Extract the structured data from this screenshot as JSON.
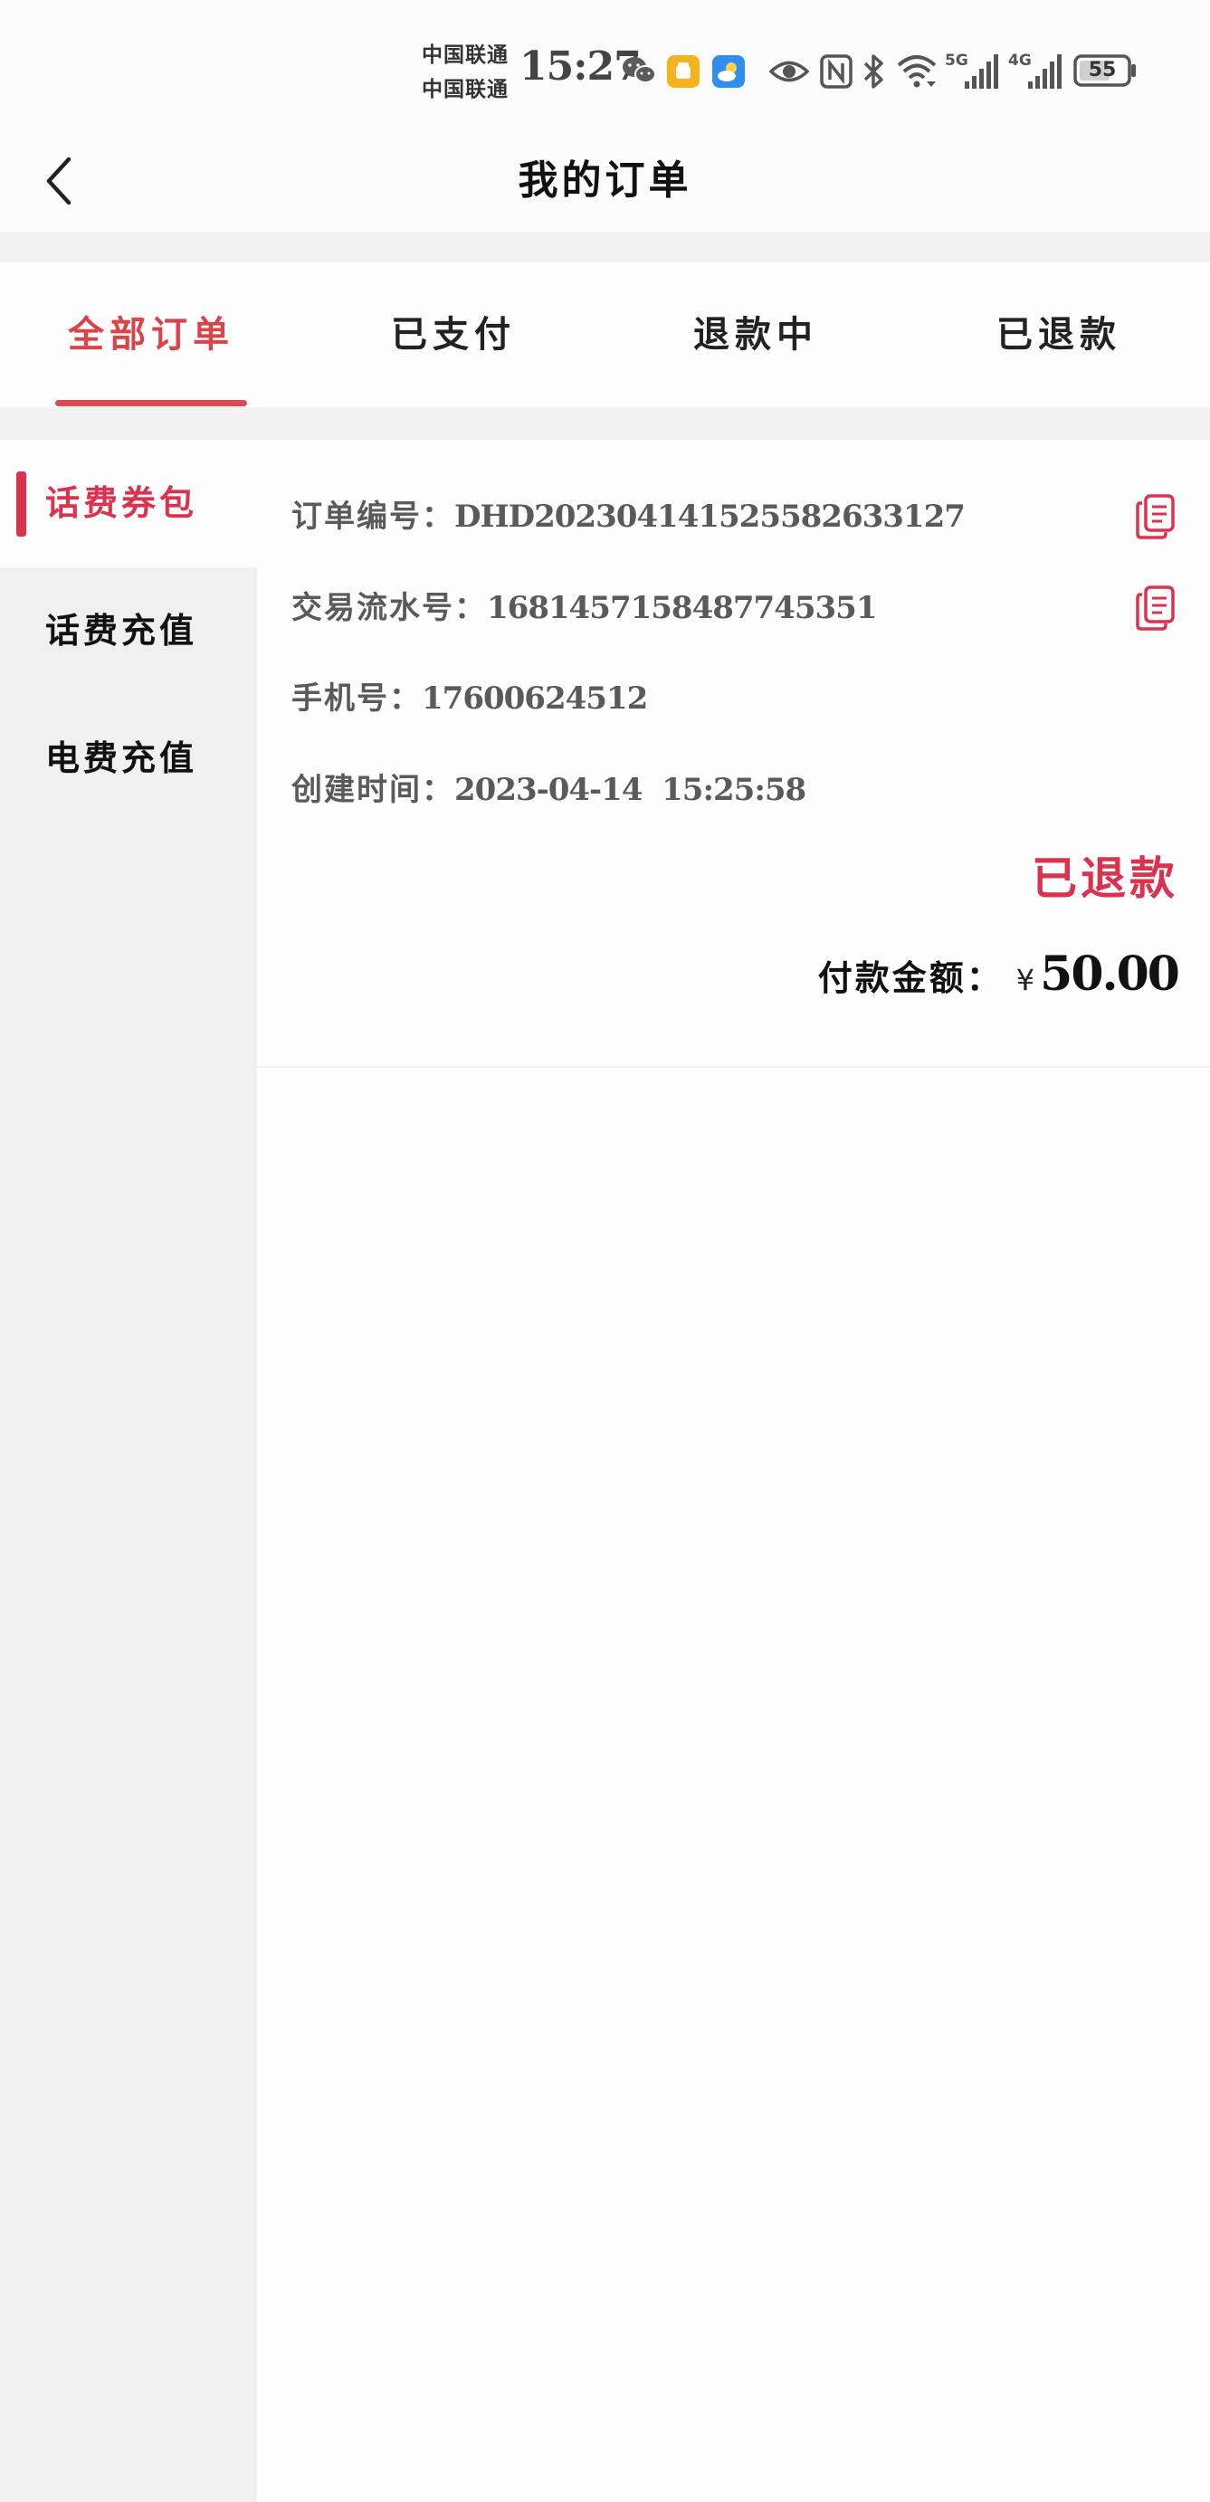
{
  "status_bar": {
    "carrier_1": "中国联通",
    "carrier_2": "中国联通",
    "time": "15:27",
    "net_1": "5G",
    "net_2": "4G",
    "battery": "55"
  },
  "header": {
    "title": "我的订单"
  },
  "tabs": [
    {
      "label": "全部订单",
      "active": true
    },
    {
      "label": "已支付",
      "active": false
    },
    {
      "label": "退款中",
      "active": false
    },
    {
      "label": "已退款",
      "active": false
    }
  ],
  "sidebar": {
    "items": [
      {
        "label": "话费券包",
        "active": true
      },
      {
        "label": "话费充值",
        "active": false
      },
      {
        "label": "电费充值",
        "active": false
      }
    ]
  },
  "order": {
    "order_no_label": "订单编号：",
    "order_no": "DHD20230414152558263312​7",
    "txn_label": "交易流水号：",
    "txn_no": "1681457158487745351",
    "phone_label": "手机号：",
    "phone": "17600624512",
    "created_label": "创建时间：",
    "created": "2023-04-14  15:25:58",
    "status": "已退款",
    "pay_label": "付款金额：",
    "currency": "¥",
    "amount": "50.00"
  },
  "colors": {
    "accent": "#d9334f",
    "tab_active": "#d9434a",
    "underline": "#e04950",
    "wechat_green": "#555555",
    "app_orange": "#f5b320",
    "app_blue": "#2f8ff0"
  }
}
